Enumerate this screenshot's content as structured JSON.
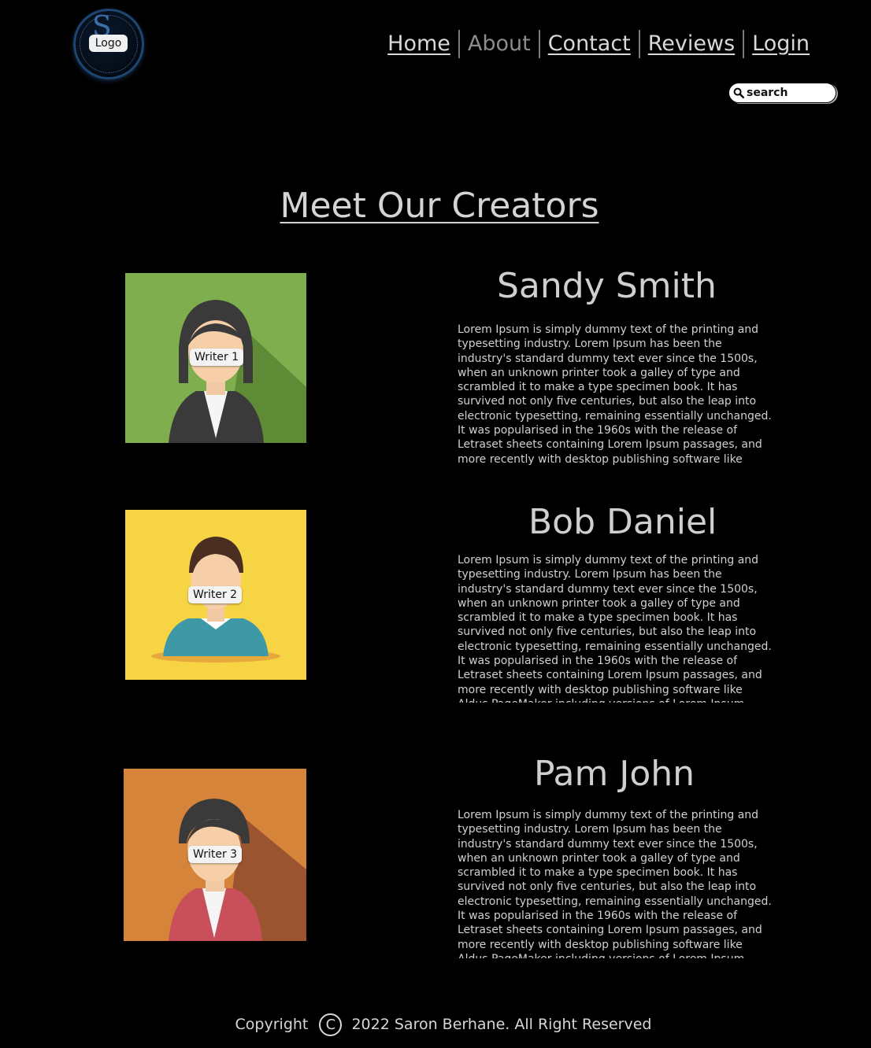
{
  "header": {
    "logo_label": "Logo",
    "nav": [
      {
        "label": "Home",
        "active": false
      },
      {
        "label": "About",
        "active": true
      },
      {
        "label": "Contact",
        "active": false
      },
      {
        "label": "Reviews",
        "active": false
      },
      {
        "label": "Login",
        "active": false
      }
    ],
    "search": {
      "placeholder": "search",
      "icon": "search-icon"
    }
  },
  "main": {
    "title": "Meet Our Creators",
    "creators": [
      {
        "name": "Sandy Smith",
        "image_label": "Writer 1",
        "bio": "Lorem Ipsum is simply dummy text of the printing and typesetting industry. Lorem Ipsum has been the industry's standard dummy text ever since the 1500s, when an unknown printer took a galley of type and scrambled it to make a type specimen book. It has survived not only five centuries, but also the leap into electronic typesetting, remaining essentially unchanged. It was popularised in the 1960s with the release of Letraset sheets containing Lorem Ipsum passages, and more recently with desktop publishing software like Aldus PageMaker including",
        "avatar_bg": "#7fae4e"
      },
      {
        "name": "Bob Daniel",
        "image_label": "Writer 2",
        "bio": "Lorem Ipsum is simply dummy text of the printing and typesetting industry. Lorem Ipsum has been the industry's standard dummy text ever since the 1500s, when an unknown printer took a galley of type and scrambled it to make a type specimen book. It has survived not only five centuries, but also the leap into electronic typesetting, remaining essentially unchanged. It was popularised in the 1960s with the release of Letraset sheets containing Lorem Ipsum passages, and more recently with desktop publishing software like Aldus PageMaker including versions of Lorem Ipsum.",
        "avatar_bg": "#f6d443"
      },
      {
        "name": "Pam John",
        "image_label": "Writer 3",
        "bio": "Lorem Ipsum is simply dummy text of the printing and typesetting industry. Lorem Ipsum has been the industry's standard dummy text ever since the 1500s, when an unknown printer took a galley of type and scrambled it to make a type specimen book. It has survived not only five centuries, but also the leap into electronic typesetting, remaining essentially unchanged. It was popularised in the 1960s with the release of Letraset sheets containing Lorem Ipsum passages, and more recently with desktop publishing software like Aldus PageMaker including versions of Lorem Ipsum.",
        "avatar_bg": "#d5843a"
      }
    ]
  },
  "footer": {
    "prefix": "Copyright",
    "symbol": "C",
    "text": "2022 Saron Berhane. All Right Reserved"
  },
  "colors": {
    "background": "#000000",
    "text": "#d8d8d8",
    "nav_active": "#8c8c8c"
  }
}
